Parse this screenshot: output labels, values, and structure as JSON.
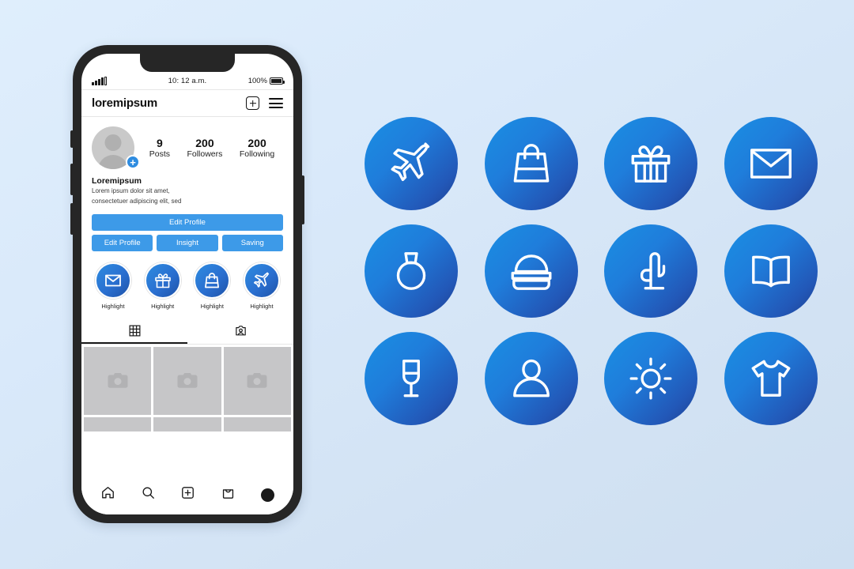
{
  "background": {
    "color_top": "#dfeefc",
    "color_bottom": "#cedff1"
  },
  "phone": {
    "status_bar": {
      "signal_icon": "signal-bars-icon",
      "time": "10: 12 a.m.",
      "battery_percent": "100%",
      "battery_icon": "battery-full-icon"
    },
    "app_header": {
      "title": "loremipsum",
      "add_icon": "plus-box-icon",
      "menu_icon": "hamburger-menu-icon"
    },
    "profile": {
      "avatar_icon": "avatar-placeholder-icon",
      "avatar_badge": "+",
      "stats": [
        {
          "number": "9",
          "label": "Posts"
        },
        {
          "number": "200",
          "label": "Followers"
        },
        {
          "number": "200",
          "label": "Following"
        }
      ],
      "display_name": "Loremipsum",
      "bio_line1": "Lorem ipsum dolor sit amet,",
      "bio_line2": "consectetuer adipiscing elit, sed"
    },
    "buttons": {
      "primary": "Edit Profile",
      "row": [
        "Edit Profile",
        "Insight",
        "Saving"
      ],
      "color": "#3d9ae8"
    },
    "highlights": [
      {
        "icon": "envelope-icon",
        "label": "Highlight"
      },
      {
        "icon": "gift-icon",
        "label": "Highlight"
      },
      {
        "icon": "shopping-bag-icon",
        "label": "Highlight"
      },
      {
        "icon": "airplane-icon",
        "label": "Highlight"
      }
    ],
    "tabs": [
      {
        "icon": "grid-icon",
        "active": true
      },
      {
        "icon": "tagged-person-icon",
        "active": false
      }
    ],
    "photo_grid": {
      "placeholder_icon": "camera-icon",
      "count": 3,
      "fill_color": "#c6c6c8"
    },
    "bottom_nav": [
      {
        "icon": "home-icon"
      },
      {
        "icon": "search-icon"
      },
      {
        "icon": "plus-box-icon"
      },
      {
        "icon": "shop-bag-icon"
      },
      {
        "icon": "profile-dot-icon"
      }
    ]
  },
  "icon_grid": {
    "gradient_start": "#1a8fe3",
    "gradient_end": "#1f3f8f",
    "icons": [
      {
        "icon": "airplane-icon"
      },
      {
        "icon": "shopping-bag-icon"
      },
      {
        "icon": "gift-icon"
      },
      {
        "icon": "envelope-icon"
      },
      {
        "icon": "ring-icon"
      },
      {
        "icon": "burger-icon"
      },
      {
        "icon": "cactus-icon"
      },
      {
        "icon": "open-book-icon"
      },
      {
        "icon": "wine-glass-icon"
      },
      {
        "icon": "person-icon"
      },
      {
        "icon": "sun-icon"
      },
      {
        "icon": "t-shirt-icon"
      }
    ]
  }
}
